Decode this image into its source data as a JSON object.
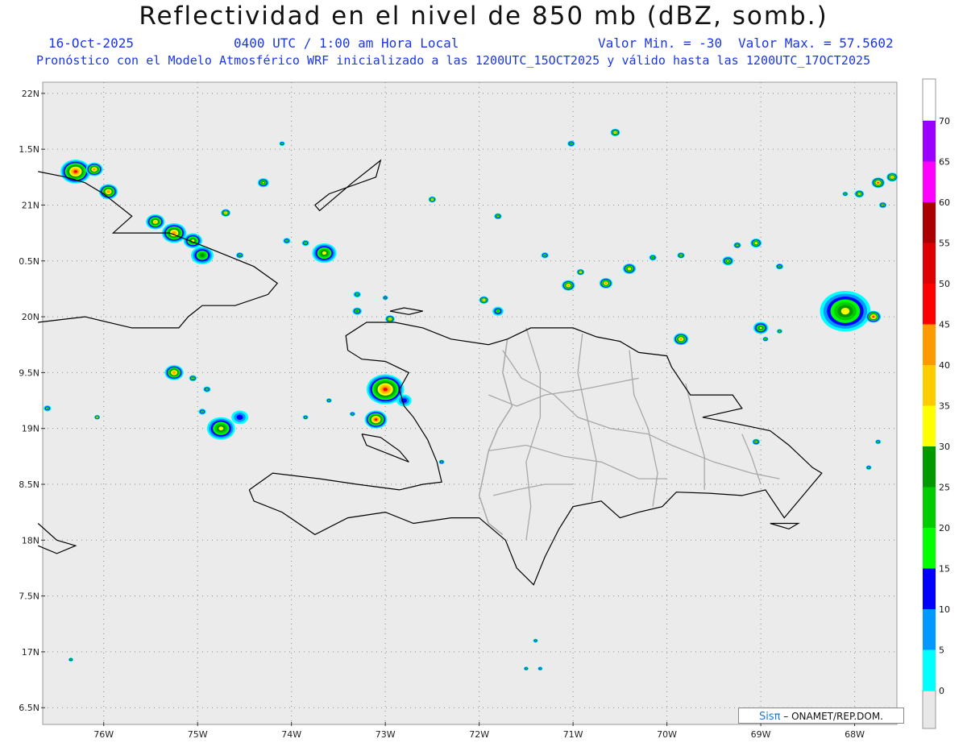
{
  "header": {
    "title": "Reflectividad en el nivel de 850 mb (dBZ, somb.)",
    "date": "16-Oct-2025",
    "time": "0400 UTC / 1:00 am Hora Local",
    "min_label": "Valor Min. = -30",
    "max_label": "Valor Max. = 57.5602",
    "forecast_info": "Pronóstico con el Modelo Atmosférico WRF inicializado a las 1200UTC_15OCT2025 y válido hasta las  1200UTC_17OCT2025"
  },
  "map": {
    "lon_range": [
      -76.65,
      -67.55
    ],
    "lat_range": [
      16.35,
      22.1
    ],
    "lat_ticks": [
      {
        "value": 22,
        "label": "22N"
      },
      {
        "value": 21.5,
        "label": "1.5N"
      },
      {
        "value": 21,
        "label": "21N"
      },
      {
        "value": 20.5,
        "label": "0.5N"
      },
      {
        "value": 20,
        "label": "20N"
      },
      {
        "value": 19.5,
        "label": "9.5N"
      },
      {
        "value": 19,
        "label": "19N"
      },
      {
        "value": 18.5,
        "label": "8.5N"
      },
      {
        "value": 18,
        "label": "18N"
      },
      {
        "value": 17.5,
        "label": "7.5N"
      },
      {
        "value": 17,
        "label": "17N"
      },
      {
        "value": 16.5,
        "label": "6.5N"
      }
    ],
    "lon_ticks": [
      {
        "value": -76,
        "label": "76W"
      },
      {
        "value": -75,
        "label": "75W"
      },
      {
        "value": -74,
        "label": "74W"
      },
      {
        "value": -73,
        "label": "73W"
      },
      {
        "value": -72,
        "label": "72W"
      },
      {
        "value": -71,
        "label": "71W"
      },
      {
        "value": -70,
        "label": "70W"
      },
      {
        "value": -69,
        "label": "69W"
      },
      {
        "value": -68,
        "label": "68W"
      }
    ],
    "colors": {
      "background": "#ebebeb",
      "coast": "#000000",
      "provinces": "#a8a8a8",
      "grid": "#8a8a8a"
    },
    "coastlines": [
      {
        "name": "hispaniola",
        "points": [
          [
            -74.45,
            18.45
          ],
          [
            -74.2,
            18.6
          ],
          [
            -73.7,
            18.55
          ],
          [
            -73.3,
            18.5
          ],
          [
            -72.85,
            18.45
          ],
          [
            -72.6,
            18.5
          ],
          [
            -72.4,
            18.52
          ],
          [
            -72.45,
            18.7
          ],
          [
            -72.55,
            18.9
          ],
          [
            -72.7,
            19.1
          ],
          [
            -72.8,
            19.2
          ],
          [
            -72.85,
            19.35
          ],
          [
            -72.75,
            19.5
          ],
          [
            -73.0,
            19.6
          ],
          [
            -73.25,
            19.62
          ],
          [
            -73.4,
            19.7
          ],
          [
            -73.42,
            19.83
          ],
          [
            -73.2,
            19.95
          ],
          [
            -72.9,
            19.95
          ],
          [
            -72.6,
            19.9
          ],
          [
            -72.3,
            19.8
          ],
          [
            -71.9,
            19.75
          ],
          [
            -71.7,
            19.8
          ],
          [
            -71.45,
            19.9
          ],
          [
            -71.0,
            19.9
          ],
          [
            -70.75,
            19.82
          ],
          [
            -70.5,
            19.78
          ],
          [
            -70.3,
            19.68
          ],
          [
            -70.0,
            19.65
          ],
          [
            -69.95,
            19.55
          ],
          [
            -69.75,
            19.3
          ],
          [
            -69.3,
            19.3
          ],
          [
            -69.2,
            19.18
          ],
          [
            -69.62,
            19.1
          ],
          [
            -69.3,
            19.05
          ],
          [
            -68.9,
            18.98
          ],
          [
            -68.7,
            18.85
          ],
          [
            -68.45,
            18.65
          ],
          [
            -68.35,
            18.6
          ],
          [
            -68.55,
            18.4
          ],
          [
            -68.75,
            18.2
          ],
          [
            -68.95,
            18.45
          ],
          [
            -69.2,
            18.4
          ],
          [
            -69.55,
            18.42
          ],
          [
            -69.9,
            18.43
          ],
          [
            -70.05,
            18.3
          ],
          [
            -70.3,
            18.25
          ],
          [
            -70.5,
            18.2
          ],
          [
            -70.7,
            18.35
          ],
          [
            -71.0,
            18.3
          ],
          [
            -71.15,
            18.1
          ],
          [
            -71.3,
            17.85
          ],
          [
            -71.42,
            17.6
          ],
          [
            -71.6,
            17.75
          ],
          [
            -71.72,
            18.0
          ],
          [
            -72.0,
            18.2
          ],
          [
            -72.3,
            18.2
          ],
          [
            -72.7,
            18.15
          ],
          [
            -73.0,
            18.25
          ],
          [
            -73.4,
            18.2
          ],
          [
            -73.75,
            18.05
          ],
          [
            -74.1,
            18.25
          ],
          [
            -74.4,
            18.35
          ],
          [
            -74.45,
            18.45
          ]
        ]
      },
      {
        "name": "cuba",
        "points": [
          [
            -76.7,
            19.95
          ],
          [
            -76.2,
            20.0
          ],
          [
            -75.7,
            19.9
          ],
          [
            -75.2,
            19.9
          ],
          [
            -75.1,
            20.0
          ],
          [
            -74.95,
            20.1
          ],
          [
            -74.6,
            20.1
          ],
          [
            -74.25,
            20.2
          ],
          [
            -74.15,
            20.3
          ],
          [
            -74.4,
            20.45
          ],
          [
            -74.9,
            20.62
          ],
          [
            -75.3,
            20.75
          ],
          [
            -75.55,
            20.75
          ],
          [
            -75.75,
            20.75
          ],
          [
            -75.9,
            20.75
          ],
          [
            -75.7,
            20.9
          ],
          [
            -76.0,
            21.1
          ],
          [
            -76.2,
            21.2
          ],
          [
            -76.4,
            21.25
          ],
          [
            -76.7,
            21.3
          ]
        ]
      },
      {
        "name": "great-inagua",
        "points": [
          [
            -73.75,
            21.0
          ],
          [
            -73.6,
            21.1
          ],
          [
            -73.1,
            21.25
          ],
          [
            -73.05,
            21.4
          ],
          [
            -73.35,
            21.2
          ],
          [
            -73.7,
            20.95
          ],
          [
            -73.75,
            21.0
          ]
        ]
      },
      {
        "name": "tortuga",
        "points": [
          [
            -72.95,
            20.05
          ],
          [
            -72.8,
            20.08
          ],
          [
            -72.6,
            20.05
          ],
          [
            -72.75,
            20.02
          ],
          [
            -72.95,
            20.05
          ]
        ]
      },
      {
        "name": "gonave",
        "points": [
          [
            -73.25,
            18.95
          ],
          [
            -73.05,
            18.92
          ],
          [
            -72.85,
            18.8
          ],
          [
            -72.75,
            18.7
          ],
          [
            -72.9,
            18.75
          ],
          [
            -73.2,
            18.85
          ],
          [
            -73.25,
            18.95
          ]
        ]
      },
      {
        "name": "jamaica",
        "points": [
          [
            -76.7,
            18.15
          ],
          [
            -76.5,
            18.0
          ],
          [
            -76.3,
            17.95
          ],
          [
            -76.5,
            17.88
          ],
          [
            -76.7,
            17.95
          ]
        ]
      },
      {
        "name": "saona",
        "points": [
          [
            -68.9,
            18.15
          ],
          [
            -68.6,
            18.15
          ],
          [
            -68.7,
            18.1
          ],
          [
            -68.9,
            18.15
          ]
        ]
      }
    ],
    "provinces": [
      [
        [
          -71.75,
          19.7
        ],
        [
          -71.55,
          19.45
        ],
        [
          -71.2,
          19.3
        ],
        [
          -70.95,
          19.1
        ],
        [
          -70.6,
          19.0
        ],
        [
          -70.2,
          18.95
        ],
        [
          -69.95,
          18.85
        ],
        [
          -69.5,
          18.7
        ],
        [
          -69.1,
          18.6
        ],
        [
          -68.8,
          18.55
        ]
      ],
      [
        [
          -71.5,
          19.9
        ],
        [
          -71.35,
          19.5
        ],
        [
          -71.35,
          19.1
        ],
        [
          -71.5,
          18.7
        ],
        [
          -71.45,
          18.3
        ],
        [
          -71.5,
          18.0
        ]
      ],
      [
        [
          -70.9,
          19.85
        ],
        [
          -70.95,
          19.5
        ],
        [
          -70.85,
          19.1
        ],
        [
          -70.75,
          18.7
        ],
        [
          -70.8,
          18.35
        ]
      ],
      [
        [
          -70.4,
          19.7
        ],
        [
          -70.35,
          19.3
        ],
        [
          -70.2,
          19.0
        ],
        [
          -70.1,
          18.6
        ],
        [
          -70.15,
          18.3
        ]
      ],
      [
        [
          -69.8,
          19.4
        ],
        [
          -69.7,
          19.05
        ],
        [
          -69.6,
          18.75
        ],
        [
          -69.6,
          18.45
        ]
      ],
      [
        [
          -69.2,
          18.95
        ],
        [
          -69.1,
          18.75
        ],
        [
          -69.0,
          18.5
        ]
      ],
      [
        [
          -71.9,
          19.3
        ],
        [
          -71.6,
          19.2
        ],
        [
          -71.3,
          19.3
        ],
        [
          -70.9,
          19.35
        ],
        [
          -70.6,
          19.4
        ],
        [
          -70.3,
          19.45
        ]
      ],
      [
        [
          -71.9,
          18.8
        ],
        [
          -71.5,
          18.85
        ],
        [
          -71.1,
          18.75
        ],
        [
          -70.7,
          18.7
        ],
        [
          -70.3,
          18.55
        ],
        [
          -70.0,
          18.55
        ]
      ],
      [
        [
          -71.85,
          18.4
        ],
        [
          -71.6,
          18.45
        ],
        [
          -71.3,
          18.5
        ],
        [
          -71.0,
          18.5
        ]
      ]
    ],
    "haiti_border": [
      [
        -71.7,
        19.8
      ],
      [
        -71.75,
        19.5
      ],
      [
        -71.65,
        19.2
      ],
      [
        -71.8,
        19.0
      ],
      [
        -71.9,
        18.8
      ],
      [
        -71.95,
        18.6
      ],
      [
        -72.0,
        18.4
      ],
      [
        -71.9,
        18.15
      ],
      [
        -71.75,
        18.05
      ]
    ],
    "storms": [
      {
        "lon": -76.3,
        "lat": 21.3,
        "r": 0.16,
        "i": 46
      },
      {
        "lon": -76.1,
        "lat": 21.32,
        "r": 0.09,
        "i": 40
      },
      {
        "lon": -75.95,
        "lat": 21.12,
        "r": 0.1,
        "i": 44
      },
      {
        "lon": -75.45,
        "lat": 20.85,
        "r": 0.1,
        "i": 36
      },
      {
        "lon": -75.25,
        "lat": 20.75,
        "r": 0.13,
        "i": 44
      },
      {
        "lon": -75.05,
        "lat": 20.68,
        "r": 0.1,
        "i": 34
      },
      {
        "lon": -74.95,
        "lat": 20.55,
        "r": 0.12,
        "i": 28
      },
      {
        "lon": -74.7,
        "lat": 20.93,
        "r": 0.05,
        "i": 42
      },
      {
        "lon": -74.55,
        "lat": 20.55,
        "r": 0.04,
        "i": 28
      },
      {
        "lon": -74.3,
        "lat": 21.2,
        "r": 0.06,
        "i": 32
      },
      {
        "lon": -74.1,
        "lat": 21.55,
        "r": 0.03,
        "i": 24
      },
      {
        "lon": -73.65,
        "lat": 20.57,
        "r": 0.13,
        "i": 34
      },
      {
        "lon": -73.85,
        "lat": 20.66,
        "r": 0.04,
        "i": 20
      },
      {
        "lon": -74.05,
        "lat": 20.68,
        "r": 0.04,
        "i": 24
      },
      {
        "lon": -75.25,
        "lat": 19.5,
        "r": 0.1,
        "i": 42
      },
      {
        "lon": -75.05,
        "lat": 19.45,
        "r": 0.04,
        "i": 30
      },
      {
        "lon": -74.9,
        "lat": 19.35,
        "r": 0.04,
        "i": 24
      },
      {
        "lon": -74.95,
        "lat": 19.15,
        "r": 0.04,
        "i": 24
      },
      {
        "lon": -74.75,
        "lat": 19.0,
        "r": 0.15,
        "i": 34
      },
      {
        "lon": -74.55,
        "lat": 19.1,
        "r": 0.09,
        "i": 14
      },
      {
        "lon": -76.07,
        "lat": 19.1,
        "r": 0.03,
        "i": 40
      },
      {
        "lon": -76.6,
        "lat": 19.18,
        "r": 0.04,
        "i": 20
      },
      {
        "lon": -73.0,
        "lat": 19.35,
        "r": 0.2,
        "i": 46
      },
      {
        "lon": -72.8,
        "lat": 19.25,
        "r": 0.08,
        "i": 14
      },
      {
        "lon": -73.1,
        "lat": 19.08,
        "r": 0.12,
        "i": 46
      },
      {
        "lon": -72.95,
        "lat": 19.98,
        "r": 0.05,
        "i": 44
      },
      {
        "lon": -73.3,
        "lat": 20.05,
        "r": 0.05,
        "i": 28
      },
      {
        "lon": -73.3,
        "lat": 20.2,
        "r": 0.04,
        "i": 24
      },
      {
        "lon": -73.0,
        "lat": 20.17,
        "r": 0.03,
        "i": 20
      },
      {
        "lon": -72.5,
        "lat": 21.05,
        "r": 0.04,
        "i": 40
      },
      {
        "lon": -73.6,
        "lat": 19.25,
        "r": 0.03,
        "i": 24
      },
      {
        "lon": -73.85,
        "lat": 19.1,
        "r": 0.03,
        "i": 24
      },
      {
        "lon": -73.35,
        "lat": 19.13,
        "r": 0.03,
        "i": 24
      },
      {
        "lon": -72.4,
        "lat": 18.7,
        "r": 0.03,
        "i": 24
      },
      {
        "lon": -71.95,
        "lat": 20.15,
        "r": 0.05,
        "i": 44
      },
      {
        "lon": -71.8,
        "lat": 20.05,
        "r": 0.06,
        "i": 24
      },
      {
        "lon": -71.3,
        "lat": 20.55,
        "r": 0.04,
        "i": 28
      },
      {
        "lon": -71.05,
        "lat": 20.28,
        "r": 0.07,
        "i": 44
      },
      {
        "lon": -70.92,
        "lat": 20.4,
        "r": 0.04,
        "i": 42
      },
      {
        "lon": -70.65,
        "lat": 20.3,
        "r": 0.07,
        "i": 44
      },
      {
        "lon": -70.4,
        "lat": 20.43,
        "r": 0.07,
        "i": 36
      },
      {
        "lon": -70.15,
        "lat": 20.53,
        "r": 0.04,
        "i": 28
      },
      {
        "lon": -69.85,
        "lat": 20.55,
        "r": 0.04,
        "i": 32
      },
      {
        "lon": -71.02,
        "lat": 21.55,
        "r": 0.04,
        "i": 28
      },
      {
        "lon": -70.55,
        "lat": 21.65,
        "r": 0.05,
        "i": 44
      },
      {
        "lon": -71.8,
        "lat": 20.9,
        "r": 0.04,
        "i": 30
      },
      {
        "lon": -69.85,
        "lat": 19.8,
        "r": 0.08,
        "i": 44
      },
      {
        "lon": -69.0,
        "lat": 19.9,
        "r": 0.08,
        "i": 30
      },
      {
        "lon": -68.8,
        "lat": 19.87,
        "r": 0.03,
        "i": 30
      },
      {
        "lon": -68.95,
        "lat": 19.8,
        "r": 0.03,
        "i": 30
      },
      {
        "lon": -69.05,
        "lat": 20.66,
        "r": 0.06,
        "i": 36
      },
      {
        "lon": -69.25,
        "lat": 20.64,
        "r": 0.04,
        "i": 32
      },
      {
        "lon": -68.8,
        "lat": 20.45,
        "r": 0.04,
        "i": 26
      },
      {
        "lon": -69.35,
        "lat": 20.5,
        "r": 0.06,
        "i": 30
      },
      {
        "lon": -68.1,
        "lat": 20.05,
        "r": 0.27,
        "i": 34
      },
      {
        "lon": -67.8,
        "lat": 20.0,
        "r": 0.08,
        "i": 46
      },
      {
        "lon": -67.95,
        "lat": 21.1,
        "r": 0.05,
        "i": 36
      },
      {
        "lon": -67.75,
        "lat": 21.2,
        "r": 0.07,
        "i": 46
      },
      {
        "lon": -67.6,
        "lat": 21.25,
        "r": 0.06,
        "i": 44
      },
      {
        "lon": -67.7,
        "lat": 21.0,
        "r": 0.04,
        "i": 32
      },
      {
        "lon": -68.1,
        "lat": 21.1,
        "r": 0.03,
        "i": 26
      },
      {
        "lon": -69.05,
        "lat": 18.88,
        "r": 0.04,
        "i": 30
      },
      {
        "lon": -67.75,
        "lat": 18.88,
        "r": 0.03,
        "i": 28
      },
      {
        "lon": -67.85,
        "lat": 18.65,
        "r": 0.03,
        "i": 24
      },
      {
        "lon": -71.4,
        "lat": 17.1,
        "r": 0.02,
        "i": 24
      },
      {
        "lon": -71.5,
        "lat": 16.85,
        "r": 0.02,
        "i": 24
      },
      {
        "lon": -71.35,
        "lat": 16.85,
        "r": 0.02,
        "i": 22
      },
      {
        "lon": -76.35,
        "lat": 16.93,
        "r": 0.02,
        "i": 24
      }
    ]
  },
  "legend": {
    "levels": [
      "0",
      "5",
      "10",
      "15",
      "20",
      "25",
      "30",
      "35",
      "40",
      "45",
      "50",
      "55",
      "60",
      "65",
      "70"
    ],
    "colors": [
      "#00ffff",
      "#0099ff",
      "#0000ff",
      "#00ff00",
      "#00cc00",
      "#009900",
      "#ffff00",
      "#ffcc00",
      "#ff9900",
      "#ff0000",
      "#dd0000",
      "#aa0000",
      "#ff00ff",
      "#9900ff"
    ],
    "cap_color": "#e8e8e8"
  },
  "credit": {
    "brand": "Sisπ",
    "text": "– ONAMET/REP.DOM."
  }
}
